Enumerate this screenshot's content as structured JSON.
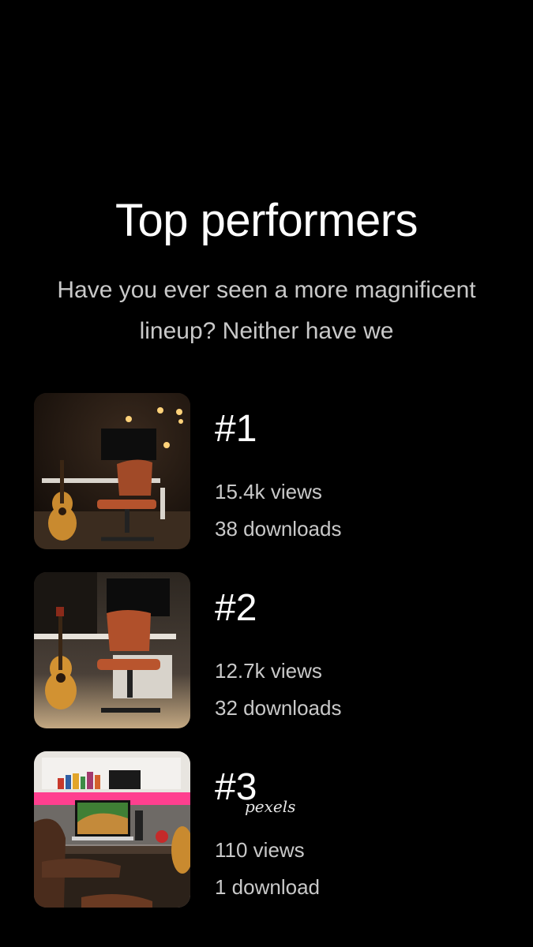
{
  "header": {
    "title": "Top performers",
    "subtitle_line1": "Have you ever seen a more magnificent",
    "subtitle_line2": "lineup? Neither have we"
  },
  "items": [
    {
      "rank": "#1",
      "views": "15.4k views",
      "downloads": "38 downloads",
      "thumb": "studio-desk-guitar-chair-lights"
    },
    {
      "rank": "#2",
      "views": "12.7k views",
      "downloads": "32 downloads",
      "thumb": "studio-desk-guitar-chair"
    },
    {
      "rank": "#3",
      "views": "110 views",
      "downloads": "1 download",
      "thumb": "desk-laptop-bookshelf"
    }
  ],
  "watermark": "pexels",
  "colors": {
    "background": "#000000",
    "title": "#ffffff",
    "body_text": "#c9c9c9"
  }
}
